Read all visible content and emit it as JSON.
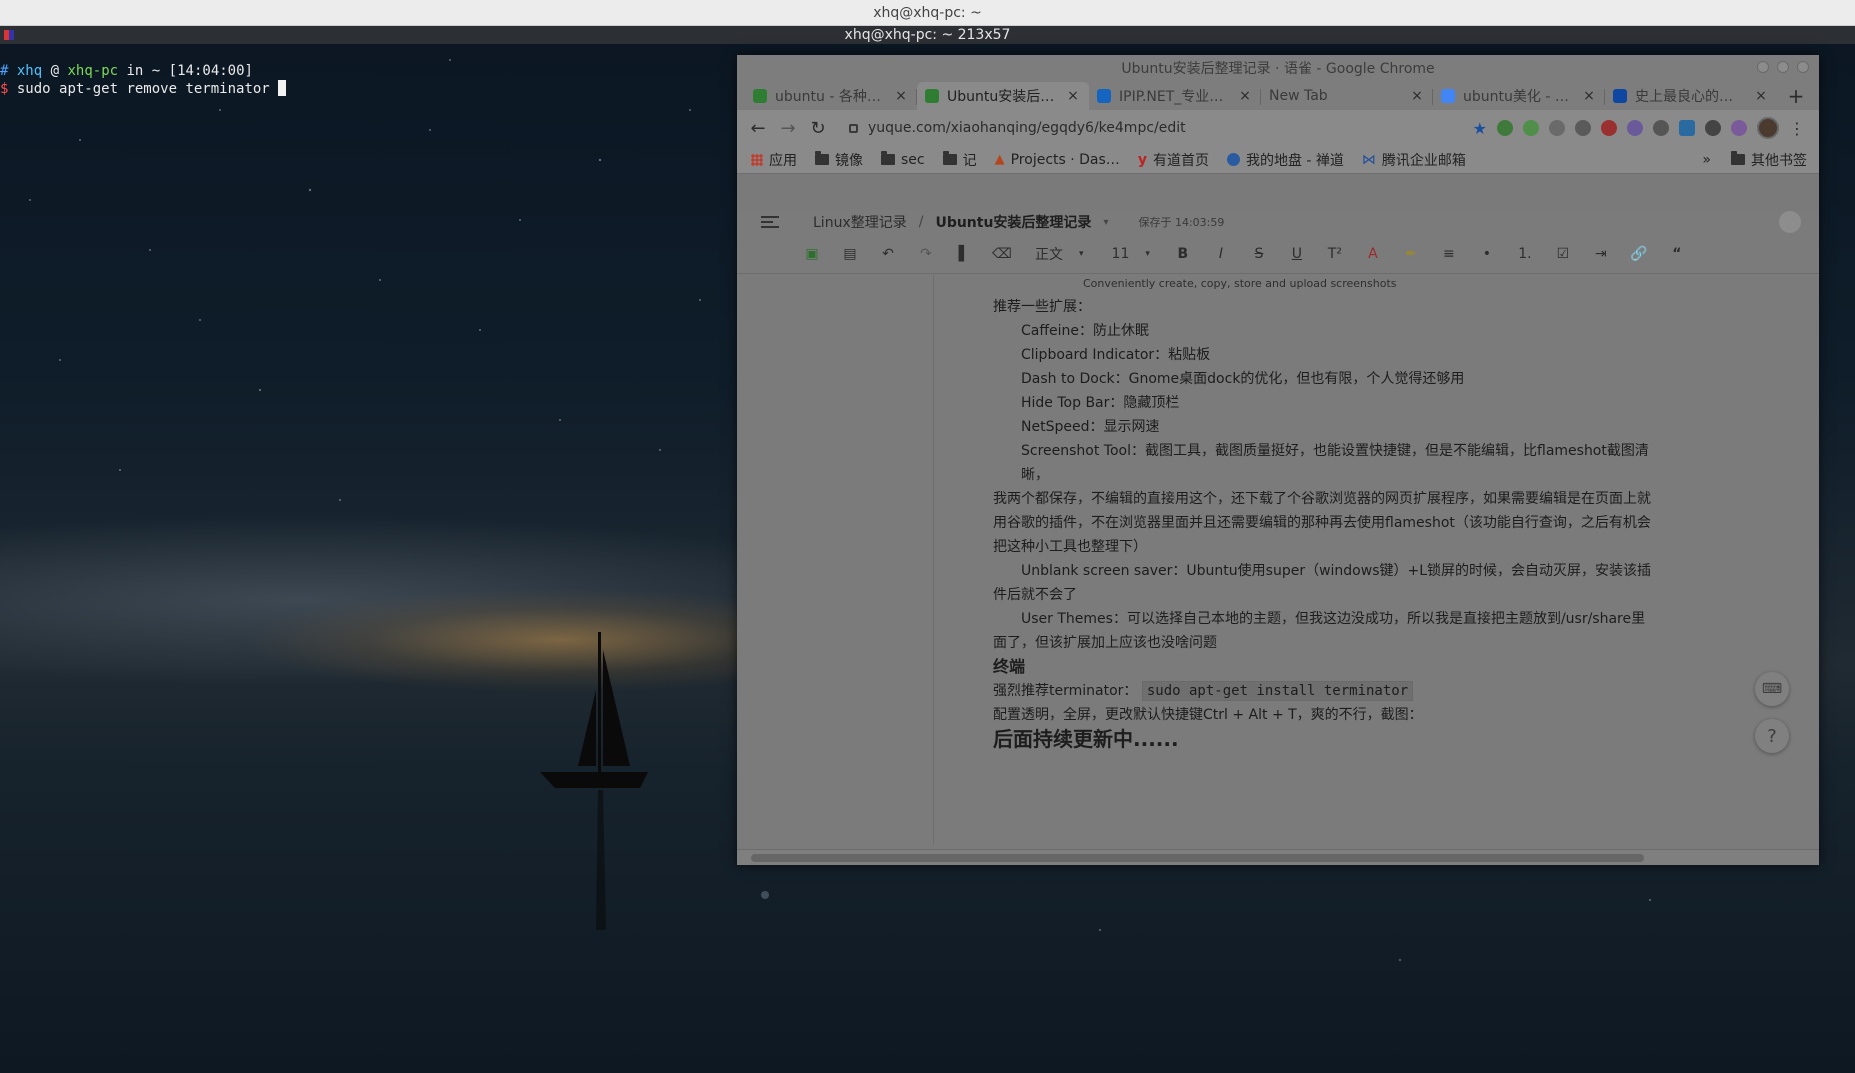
{
  "window": {
    "title": "xhq@xhq-pc: ~",
    "terminal_header": "xhq@xhq-pc: ~ 213x57"
  },
  "terminal": {
    "line1": {
      "hash": "#",
      "user": "xhq",
      "at": "@",
      "host": "xhq-pc",
      "in": "in",
      "cwd": "~",
      "time": "[14:04:00]"
    },
    "line2": {
      "prompt": "$",
      "command": "sudo apt-get remove terminator"
    }
  },
  "chrome": {
    "title": "Ubuntu安装后整理记录 · 语雀 - Google Chrome",
    "tabs": [
      {
        "label": "ubuntu - 各种…",
        "favicon_color": "#2e7d32"
      },
      {
        "label": "Ubuntu安装后…",
        "favicon_color": "#2e7d32"
      },
      {
        "label": "IPIP.NET_专业…",
        "favicon_color": "#1565c0"
      },
      {
        "label": "New Tab",
        "favicon_color": ""
      },
      {
        "label": "ubuntu美化 - …",
        "favicon_color": "#4285f4"
      },
      {
        "label": "史上最良心的…",
        "favicon_color": "#0d47a1"
      }
    ],
    "close_glyph": "×",
    "new_tab_glyph": "+",
    "url": "yuque.com/xiaohanqing/egqdy6/ke4mpc/edit",
    "bookmarks": [
      {
        "label": "应用",
        "icon": "apps-grid-icon"
      },
      {
        "label": "镜像",
        "icon": "folder-icon"
      },
      {
        "label": "sec",
        "icon": "folder-icon"
      },
      {
        "label": "记",
        "icon": "folder-icon"
      },
      {
        "label": "Projects · Das…",
        "icon": "gitlab-icon"
      },
      {
        "label": "有道首页",
        "icon": "youdao-icon"
      },
      {
        "label": "我的地盘 - 禅道",
        "icon": "zentao-icon"
      },
      {
        "label": "腾讯企业邮箱",
        "icon": "mail-icon"
      }
    ],
    "bookmarks_overflow": "»",
    "other_bookmarks": "其他书签"
  },
  "yuque": {
    "breadcrumb_parent": "Linux整理记录",
    "breadcrumb_sep": "/",
    "doc_title": "Ubuntu安装后整理记录",
    "saved_at": "保存于 14:03:59",
    "toolbar": {
      "style": "正文",
      "font_size": "11"
    },
    "screenshot_tip": "Conveniently create, copy, store and upload screenshots",
    "body": {
      "recommend_heading": "推荐一些扩展：",
      "items": [
        "Caffeine：防止休眠",
        "Clipboard Indicator：粘贴板",
        "Dash to Dock：Gnome桌面dock的优化，但也有限，个人觉得还够用",
        "Hide Top Bar：隐藏顶栏",
        "NetSpeed：显示网速"
      ],
      "screenshot_tool": "Screenshot Tool：截图工具，截图质量挺好，也能设置快捷键，但是不能编辑，比flameshot截图清晰，",
      "screenshot_tool_cont": "我两个都保存，不编辑的直接用这个，还下载了个谷歌浏览器的网页扩展程序，如果需要编辑是在页面上就用谷歌的插件，不在浏览器里面并且还需要编辑的那种再去使用flameshot（该功能自行查询，之后有机会把这种小工具也整理下）",
      "unblank": "Unblank screen saver：Ubuntu使用super（windows键）+L锁屏的时候，会自动灭屏，安装该插件后就不会了",
      "user_themes": "User Themes：可以选择自己本地的主题，但我这边没成功，所以我是直接把主题放到/usr/share里面了，但该扩展加上应该也没啥问题",
      "terminal_heading": "终端",
      "recommend_terminator": "强烈推荐terminator：",
      "install_cmd": "sudo apt-get install terminator",
      "config_line": "配置透明，全屏，更改默认快捷键Ctrl + Alt + T，爽的不行，截图：",
      "more_heading": "后面持续更新中......"
    },
    "help_glyph": "?"
  }
}
